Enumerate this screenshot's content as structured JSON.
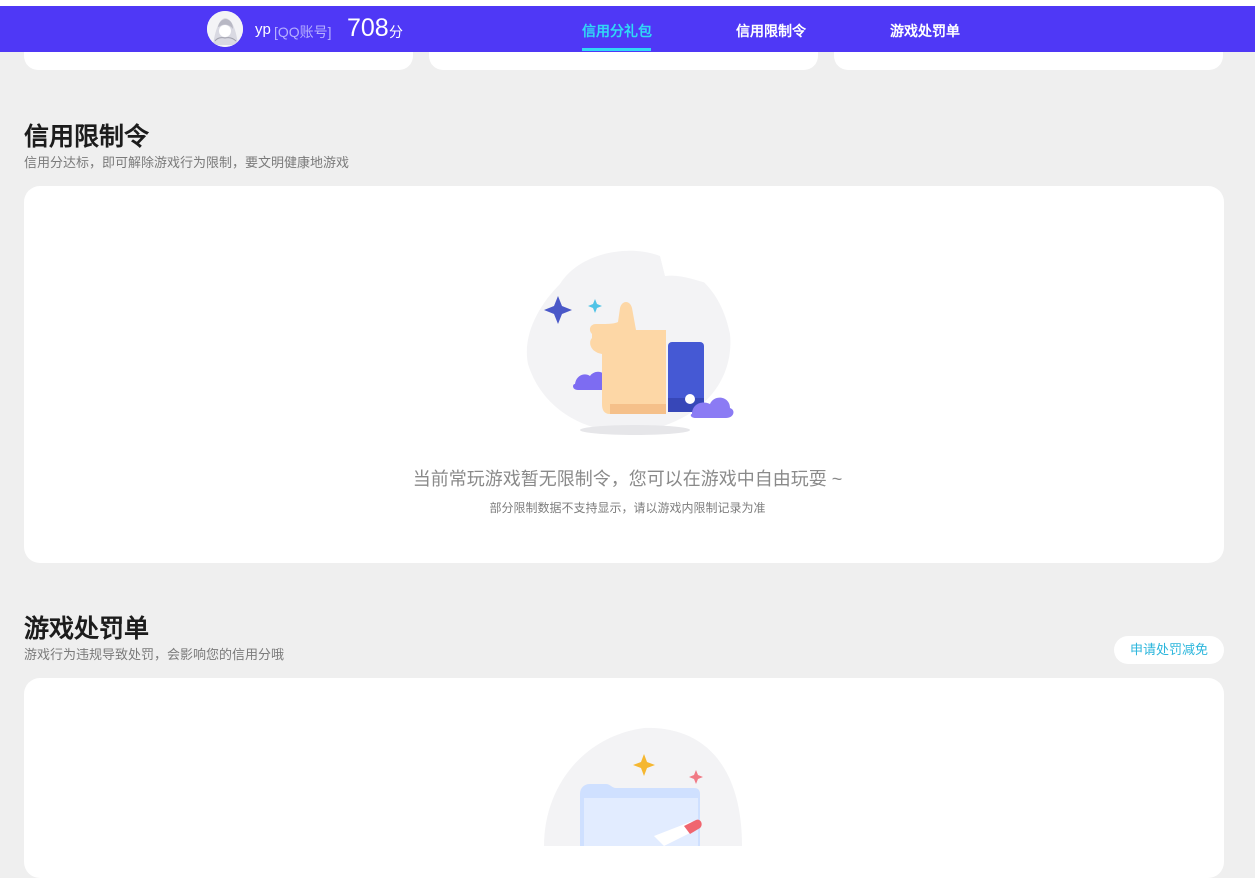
{
  "header": {
    "username": "yp",
    "account_type": "[QQ账号]",
    "score": "708",
    "score_unit": "分",
    "tabs": [
      {
        "label": "信用分礼包",
        "active": true
      },
      {
        "label": "信用限制令",
        "active": false
      },
      {
        "label": "游戏处罚单",
        "active": false
      }
    ]
  },
  "restriction": {
    "title": "信用限制令",
    "subtitle": "信用分达标，即可解除游戏行为限制，要文明健康地游戏",
    "empty_message": "当前常玩游戏暂无限制令，您可以在游戏中自由玩耍 ~",
    "empty_note": "部分限制数据不支持显示，请以游戏内限制记录为准"
  },
  "penalty": {
    "title": "游戏处罚单",
    "subtitle": "游戏行为违规导致处罚，会影响您的信用分哦",
    "appeal_button": "申请处罚减免"
  },
  "colors": {
    "brand": "#4f38f6",
    "accent": "#30d9f5",
    "link": "#2bb6dc",
    "background": "#efefef"
  }
}
